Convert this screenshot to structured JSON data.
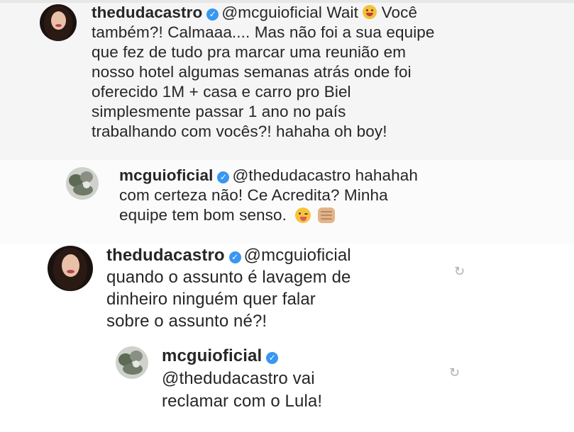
{
  "comments": [
    {
      "username": "thedudacastro",
      "verified_icon": "verified-badge-icon",
      "lines": [
        "@mcguioficial Wait",
        "Você",
        "também?! Calmaaa.... Mas não foi a sua equipe",
        "que fez de tudo pra marcar uma reunião em",
        "nosso hotel algumas semanas atrás onde foi",
        "oferecido 1M + casa e carro pro Biel",
        "simplesmente passar 1 ano no país",
        "trabalhando com vocês?! hahaha oh boy!"
      ],
      "emoji": "rofl-emoji"
    },
    {
      "username": "mcguioficial",
      "verified_icon": "verified-badge-icon",
      "lines": [
        "@thedudacastro hahahah",
        "com certeza não! Ce Acredita? Minha",
        "equipe tem bom senso."
      ],
      "emojis": [
        "winking-tongue-emoji",
        "fist-bump-emoji"
      ]
    },
    {
      "username": "thedudacastro",
      "verified_icon": "verified-badge-icon",
      "lines": [
        "@mcguioficial",
        "quando o assunto é lavagem de",
        "dinheiro ninguém quer falar",
        "sobre o assunto né?!"
      ],
      "reply_icon": "reply-arrow-icon"
    },
    {
      "username": "mcguioficial",
      "verified_icon": "verified-badge-icon",
      "lines": [
        "@thedudacastro vai",
        "reclamar com o Lula!"
      ],
      "reply_icon": "reply-arrow-icon"
    }
  ],
  "colors": {
    "verified": "#3897f0",
    "text": "#262626",
    "reply_icon": "#b0b0b0"
  }
}
